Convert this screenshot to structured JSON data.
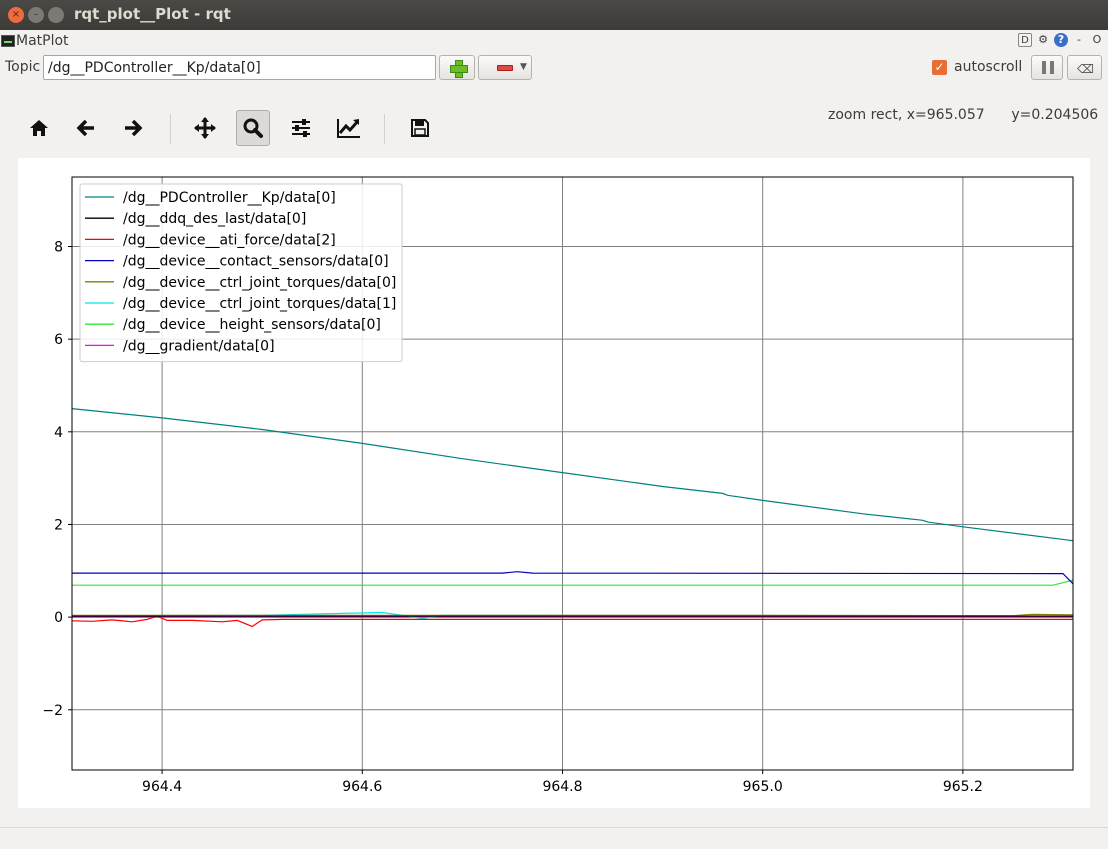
{
  "window": {
    "title": "rqt_plot__Plot - rqt",
    "buttons": [
      "close",
      "minimize",
      "maximize"
    ]
  },
  "plugin": {
    "title": "MatPlot",
    "header_icons": [
      "D",
      "gear-icon",
      "help-icon",
      "-",
      "O"
    ]
  },
  "topic": {
    "label": "Topic",
    "value": "/dg__PDController__Kp/data[0]"
  },
  "autoscroll": {
    "label": "autoscroll",
    "checked": true
  },
  "toolbar": {
    "buttons": [
      "home-icon",
      "back-icon",
      "forward-icon",
      "pan-icon",
      "zoom-icon",
      "configure-subplots-icon",
      "edit-axis-icon",
      "save-icon"
    ],
    "active": "zoom-icon"
  },
  "status": {
    "mode": "zoom rect",
    "x_text": "x=965.057",
    "y_text": "y=0.204506"
  },
  "colors": {
    "accent": "#e96d35",
    "titlebar": "#3c3b37"
  },
  "chart_data": {
    "type": "line",
    "xlim": [
      964.31,
      965.31
    ],
    "ylim": [
      -3.3,
      9.5
    ],
    "xticks": [
      964.4,
      964.6,
      964.8,
      965.0,
      965.2
    ],
    "xtick_labels": [
      "964.4",
      "964.6",
      "964.8",
      "965.0",
      "965.2"
    ],
    "yticks": [
      -2,
      0,
      2,
      4,
      6,
      8
    ],
    "ytick_labels": [
      "−2",
      "0",
      "2",
      "4",
      "6",
      "8"
    ],
    "grid": true,
    "legend_position": "upper-left",
    "series": [
      {
        "name": "/dg__PDController__Kp/data[0]",
        "color": "#008080",
        "x": [
          964.31,
          964.4,
          964.5,
          964.6,
          964.7,
          964.8,
          964.9,
          964.96,
          964.965,
          965.0,
          965.1,
          965.16,
          965.165,
          965.2,
          965.31
        ],
        "y": [
          4.5,
          4.3,
          4.05,
          3.75,
          3.42,
          3.12,
          2.82,
          2.67,
          2.63,
          2.52,
          2.23,
          2.09,
          2.05,
          1.95,
          1.65
        ]
      },
      {
        "name": "/dg__ddq_des_last/data[0]",
        "color": "#000000",
        "x": [
          964.31,
          965.31
        ],
        "y": [
          0.02,
          0.02
        ]
      },
      {
        "name": "/dg__device__ati_force/data[2]",
        "color": "#ff0000",
        "x": [
          964.31,
          964.33,
          964.35,
          964.37,
          964.385,
          964.395,
          964.405,
          964.43,
          964.46,
          964.475,
          964.49,
          964.5,
          964.52,
          965.31
        ],
        "y": [
          -0.08,
          -0.09,
          -0.06,
          -0.1,
          -0.05,
          0.02,
          -0.07,
          -0.07,
          -0.1,
          -0.07,
          -0.2,
          -0.06,
          -0.05,
          -0.05
        ]
      },
      {
        "name": "/dg__device__contact_sensors/data[0]",
        "color": "#0000c0",
        "x": [
          964.31,
          964.74,
          964.755,
          964.77,
          965.3,
          965.31
        ],
        "y": [
          0.95,
          0.95,
          0.98,
          0.95,
          0.94,
          0.72
        ]
      },
      {
        "name": "/dg__device__ctrl_joint_torques/data[0]",
        "color": "#808000",
        "x": [
          964.31,
          964.6,
          965.0,
          965.25,
          965.27,
          965.31
        ],
        "y": [
          0.04,
          0.04,
          0.04,
          0.03,
          0.06,
          0.05
        ]
      },
      {
        "name": "/dg__device__ctrl_joint_torques/data[1]",
        "color": "#00e5ee",
        "x": [
          964.31,
          964.5,
          964.58,
          964.62,
          964.64,
          964.66,
          964.68,
          965.31
        ],
        "y": [
          0.03,
          0.04,
          0.08,
          0.1,
          0.04,
          -0.03,
          0.04,
          0.03
        ]
      },
      {
        "name": "/dg__device__height_sensors/data[0]",
        "color": "#32e632",
        "x": [
          964.31,
          965.29,
          965.31
        ],
        "y": [
          0.69,
          0.69,
          0.8
        ]
      },
      {
        "name": "/dg__gradient/data[0]",
        "color": "#ff00ff",
        "x": [
          964.31,
          965.31
        ],
        "y": [
          0.0,
          0.0
        ]
      }
    ]
  }
}
